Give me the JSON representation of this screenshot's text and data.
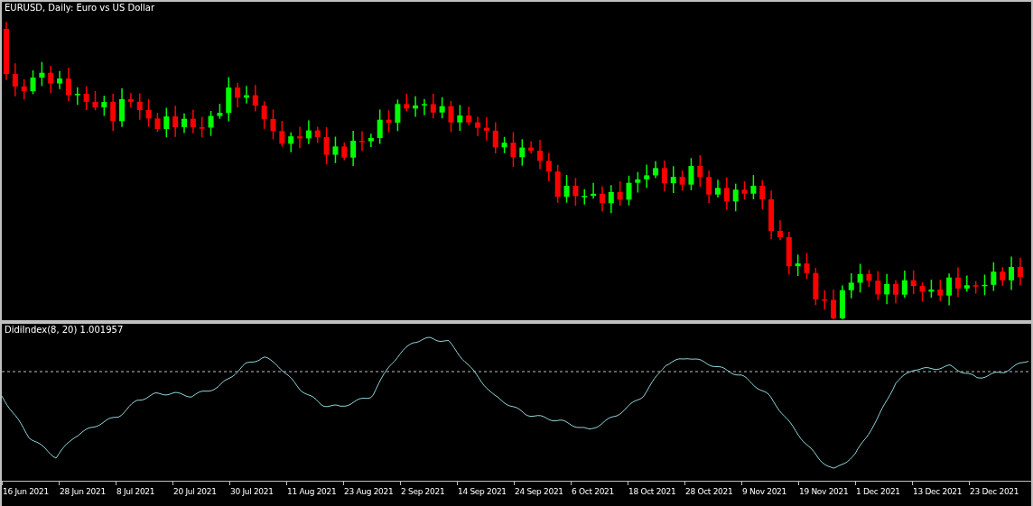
{
  "chart": {
    "title": "EURUSD, Daily: Euro vs US Dollar"
  },
  "indicator": {
    "label": "DidiIndex(8, 20) 1.001957"
  },
  "time_axis": {
    "labels": [
      "16 Jun 2021",
      "28 Jun 2021",
      "8 Jul 2021",
      "20 Jul 2021",
      "30 Jul 2021",
      "11 Aug 2021",
      "23 Aug 2021",
      "2 Sep 2021",
      "14 Sep 2021",
      "24 Sep 2021",
      "6 Oct 2021",
      "18 Oct 2021",
      "28 Oct 2021",
      "9 Nov 2021",
      "19 Nov 2021",
      "1 Dec 2021",
      "13 Dec 2021",
      "23 Dec 2021"
    ]
  }
}
